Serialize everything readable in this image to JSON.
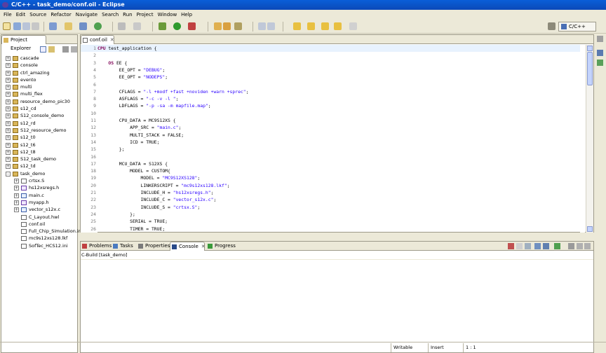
{
  "window": {
    "title": "C/C++ - task_demo/conf.oil - Eclipse"
  },
  "menu": [
    "File",
    "Edit",
    "Source",
    "Refactor",
    "Navigate",
    "Search",
    "Run",
    "Project",
    "Window",
    "Help"
  ],
  "perspective": {
    "label": "C/C++"
  },
  "project_explorer": {
    "tab_label": "Project Explorer",
    "items": [
      {
        "label": "cascade",
        "level": 0,
        "kind": "project",
        "expander": "+"
      },
      {
        "label": "console",
        "level": 0,
        "kind": "project",
        "expander": "+"
      },
      {
        "label": "ctrl_amazing",
        "level": 0,
        "kind": "project",
        "expander": "+"
      },
      {
        "label": "evento",
        "level": 0,
        "kind": "project",
        "expander": "+"
      },
      {
        "label": "multi",
        "level": 0,
        "kind": "project",
        "expander": "+"
      },
      {
        "label": "multi_flex",
        "level": 0,
        "kind": "project",
        "expander": "+"
      },
      {
        "label": "resource_demo_pic30",
        "level": 0,
        "kind": "project",
        "expander": "+"
      },
      {
        "label": "s12_cd",
        "level": 0,
        "kind": "project",
        "expander": "+"
      },
      {
        "label": "S12_console_demo",
        "level": 0,
        "kind": "project",
        "expander": "+"
      },
      {
        "label": "s12_rd",
        "level": 0,
        "kind": "project",
        "expander": "+"
      },
      {
        "label": "S12_resource_demo",
        "level": 0,
        "kind": "project",
        "expander": "+"
      },
      {
        "label": "s12_t0",
        "level": 0,
        "kind": "project",
        "expander": "+"
      },
      {
        "label": "s12_t6",
        "level": 0,
        "kind": "project",
        "expander": "+"
      },
      {
        "label": "s12_t8",
        "level": 0,
        "kind": "project",
        "expander": "+"
      },
      {
        "label": "S12_task_demo",
        "level": 0,
        "kind": "project",
        "expander": "+"
      },
      {
        "label": "s12_td",
        "level": 0,
        "kind": "project",
        "expander": "+"
      },
      {
        "label": "task_demo",
        "level": 0,
        "kind": "project",
        "expander": "-"
      },
      {
        "label": "crtsx.S",
        "level": 1,
        "kind": "file",
        "expander": "+"
      },
      {
        "label": "hs12xsregs.h",
        "level": 1,
        "kind": "hfile",
        "expander": "+"
      },
      {
        "label": "main.c",
        "level": 1,
        "kind": "cfile",
        "expander": "+"
      },
      {
        "label": "myapp.h",
        "level": 1,
        "kind": "hfile",
        "expander": "+"
      },
      {
        "label": "vector_s12x.c",
        "level": 1,
        "kind": "cfile",
        "expander": "+"
      },
      {
        "label": "C_Layout.hwl",
        "level": 1,
        "kind": "file",
        "expander": ""
      },
      {
        "label": "conf.oil",
        "level": 1,
        "kind": "file",
        "expander": ""
      },
      {
        "label": "Full_Chip_Simulation.ini",
        "level": 1,
        "kind": "file",
        "expander": ""
      },
      {
        "label": "mc9s12xs128.lkf",
        "level": 1,
        "kind": "file",
        "expander": ""
      },
      {
        "label": "SofTec_HCS12.ini",
        "level": 1,
        "kind": "file",
        "expander": ""
      }
    ]
  },
  "editor": {
    "tab_label": "conf.oil",
    "lines": [
      {
        "n": "1",
        "t": "CPU test_application {"
      },
      {
        "n": "2",
        "t": ""
      },
      {
        "n": "3",
        "t": "    OS EE {"
      },
      {
        "n": "4",
        "t": "        EE_OPT = \"DEBUG\";"
      },
      {
        "n": "5",
        "t": "        EE_OPT = \"NODEPS\";"
      },
      {
        "n": "6",
        "t": ""
      },
      {
        "n": "7",
        "t": "        CFLAGS = \"-l +modf +fast +noviden +warn +sprec\";"
      },
      {
        "n": "8",
        "t": "        ASFLAGS = \"-c -v -l \";"
      },
      {
        "n": "9",
        "t": "        LDFLAGS = \"-p -sa -m mapfile.map\";"
      },
      {
        "n": "10",
        "t": ""
      },
      {
        "n": "11",
        "t": "        CPU_DATA = MC9S12XS {"
      },
      {
        "n": "12",
        "t": "            APP_SRC = \"main.c\";"
      },
      {
        "n": "13",
        "t": "            MULTI_STACK = FALSE;"
      },
      {
        "n": "14",
        "t": "            ICD = TRUE;"
      },
      {
        "n": "15",
        "t": "        };"
      },
      {
        "n": "16",
        "t": ""
      },
      {
        "n": "17",
        "t": "        MCU_DATA = S12XS {"
      },
      {
        "n": "18",
        "t": "            MODEL = CUSTOM{"
      },
      {
        "n": "19",
        "t": "                MODEL = \"MC9S12XS128\";"
      },
      {
        "n": "20",
        "t": "                LINKERSCRIPT = \"mc9s12xs128.lkf\";"
      },
      {
        "n": "21",
        "t": "                INCLUDE_H = \"hs12xsregs.h\";"
      },
      {
        "n": "22",
        "t": "                INCLUDE_C = \"vector_s12x.c\";"
      },
      {
        "n": "23",
        "t": "                INCLUDE_S = \"crtsx.S\";"
      },
      {
        "n": "24",
        "t": "            };"
      },
      {
        "n": "25",
        "t": "            SERIAL = TRUE;"
      },
      {
        "n": "26",
        "t": "            TIMER = TRUE;"
      }
    ]
  },
  "bottom_panel": {
    "tabs": [
      {
        "label": "Problems",
        "close": ""
      },
      {
        "label": "Tasks",
        "close": ""
      },
      {
        "label": "Properties",
        "close": ""
      },
      {
        "label": "Console",
        "close": "✕"
      },
      {
        "label": "Progress",
        "close": ""
      }
    ],
    "console_label": "C-Build [task_demo]"
  },
  "status": {
    "writable": "Writable",
    "insert": "Insert",
    "position": "1 : 1"
  }
}
